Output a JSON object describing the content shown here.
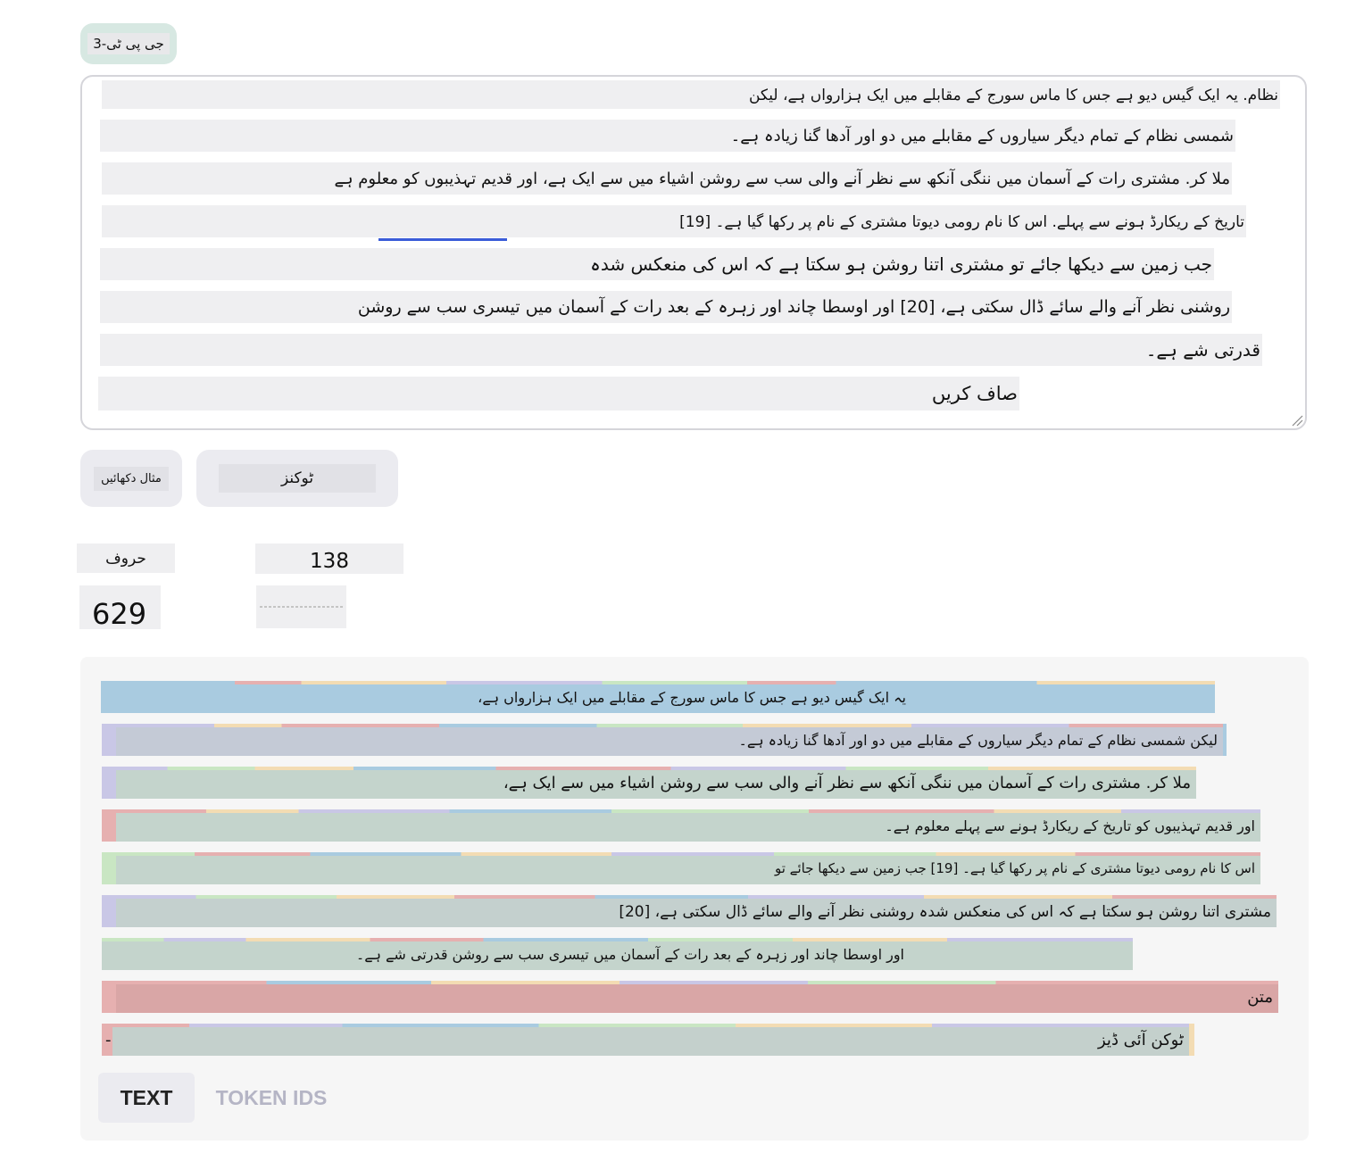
{
  "model_selector": {
    "label": "جی پی ٹی-3"
  },
  "input": {
    "lines": [
      "نظام. یہ ایک گیس دیو ہے جس کا ماس سورج کے مقابلے میں ایک ہزارواں ہے، لیکن",
      "شمسی نظام کے تمام دیگر سیاروں کے مقابلے میں دو اور آدھا گنا زیادہ ہے۔",
      "ملا کر. مشتری رات کے آسمان میں ننگی آنکھ سے نظر آنے والی سب سے روشن اشیاء میں سے ایک ہے، اور قدیم تہذیبوں کو معلوم ہے",
      "تاریخ کے ریکارڈ ہونے سے پہلے. اس کا نام رومی دیوتا مشتری کے نام پر رکھا گیا ہے۔ [19]",
      "جب زمین سے دیکھا جائے تو مشتری اتنا روشن ہو سکتا ہے کہ اس کی منعکس شدہ",
      "روشنی نظر آنے والے سائے ڈال سکتی ہے، [20] اور اوسطا چاند اور زہرہ کے بعد رات کے آسمان میں تیسری سب سے روشن",
      "قدرتی شے ہے۔",
      "صاف کریں"
    ]
  },
  "buttons": {
    "show_example": "مثال دکھائیں",
    "tokens": "ٹوکنز"
  },
  "stats": {
    "characters_label": "حروف",
    "tokens_value": "138",
    "characters_value": "629"
  },
  "tokens": {
    "rows": [
      "یہ ایک گیس دیو ہے جس کا ماس سورج کے مقابلے میں ایک ہزارواں ہے،",
      "لیکن شمسی نظام کے تمام دیگر سیاروں کے مقابلے میں دو اور آدھا گنا زیادہ ہے۔",
      "ملا کر. مشتری رات کے آسمان میں ننگی آنکھ سے نظر آنے والی سب سے روشن اشیاء میں سے ایک ہے،",
      "اور قدیم تہذیبوں کو تاریخ کے ریکارڈ ہونے سے پہلے معلوم ہے۔",
      "اس کا نام رومی دیوتا مشتری کے نام پر رکھا گیا ہے۔ [19] جب زمین سے دیکھا جائے تو",
      "مشتری اتنا روشن ہو سکتا ہے کہ اس کی منعکس شدہ روشنی نظر آنے والے سائے ڈال سکتی ہے، [20]",
      "اور اوسطا چاند اور زہرہ کے بعد رات کے آسمان میں تیسری سب سے روشن قدرتی شے ہے۔",
      "متن",
      "ٹوکن آئی ڈیز"
    ],
    "dash": "-"
  },
  "view_toggle": {
    "text": "TEXT",
    "token_ids": "TOKEN IDS"
  },
  "colors": {
    "accent_underline": "#3a5cd8",
    "token_palette": [
      "#a9cbe0",
      "#c9c7e6",
      "#c4d4cc",
      "#e6b0b0",
      "#c9e6c3",
      "#f3dcb3"
    ]
  }
}
